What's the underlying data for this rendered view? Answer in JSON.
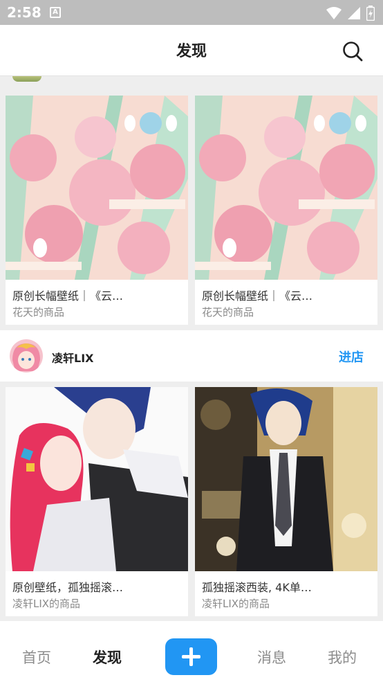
{
  "status_bar": {
    "time": "2:58",
    "notification_glyph": "A",
    "icons": [
      "wifi-icon",
      "signal-icon",
      "battery-icon"
    ]
  },
  "header": {
    "title": "发现",
    "search_icon": "search-icon"
  },
  "feed": [
    {
      "store": null,
      "items": [
        {
          "title": "原创长幅壁纸｜《云…",
          "seller": "花天的商品"
        },
        {
          "title": "原创长幅壁纸｜《云…",
          "seller": "花天的商品"
        }
      ]
    },
    {
      "store": {
        "name": "凌轩LIX",
        "enter_label": "进店"
      },
      "items": [
        {
          "title": "原创壁纸，孤独摇滚…",
          "seller": "凌轩LIX的商品"
        },
        {
          "title": "孤独摇滚西装, 4K单…",
          "seller": "凌轩LIX的商品"
        }
      ]
    }
  ],
  "bottom_nav": {
    "items": [
      "首页",
      "发现",
      "消息",
      "我的"
    ],
    "active": "发现",
    "plus_icon": "plus-icon"
  },
  "colors": {
    "accent": "#2196f3",
    "status_bar": "#bdbdbd",
    "page_bg": "#eeeeee"
  }
}
